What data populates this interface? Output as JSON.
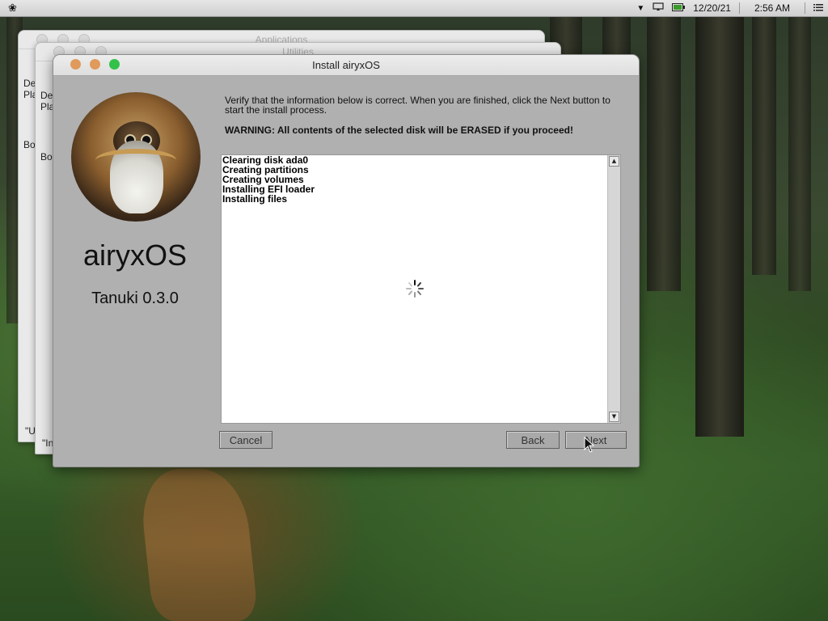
{
  "menubar": {
    "logo_icon": "airyx-leaf-icon",
    "date": "12/20/21",
    "time": "2:56 AM"
  },
  "background_windows": {
    "applications_title": "Applications",
    "utilities_title": "Utilities",
    "back_texts": [
      "De",
      "Pla",
      "Bo",
      "\"U"
    ],
    "mid_texts": [
      "De",
      "Pla",
      "Bo",
      "\"In"
    ]
  },
  "installer": {
    "window_title": "Install airyxOS",
    "product_name": "airyxOS",
    "version": "Tanuki 0.3.0",
    "instructions": "Verify that the information below is correct. When you are finished, click the Next button to start the install process.",
    "warning": "WARNING: All contents of the selected disk will be ERASED if you proceed!",
    "log_lines": [
      "Clearing disk ada0",
      "Creating partitions",
      "Creating volumes",
      "Installing EFI loader",
      "Installing files"
    ],
    "buttons": {
      "cancel": "Cancel",
      "back": "Back",
      "next": "Next"
    }
  }
}
